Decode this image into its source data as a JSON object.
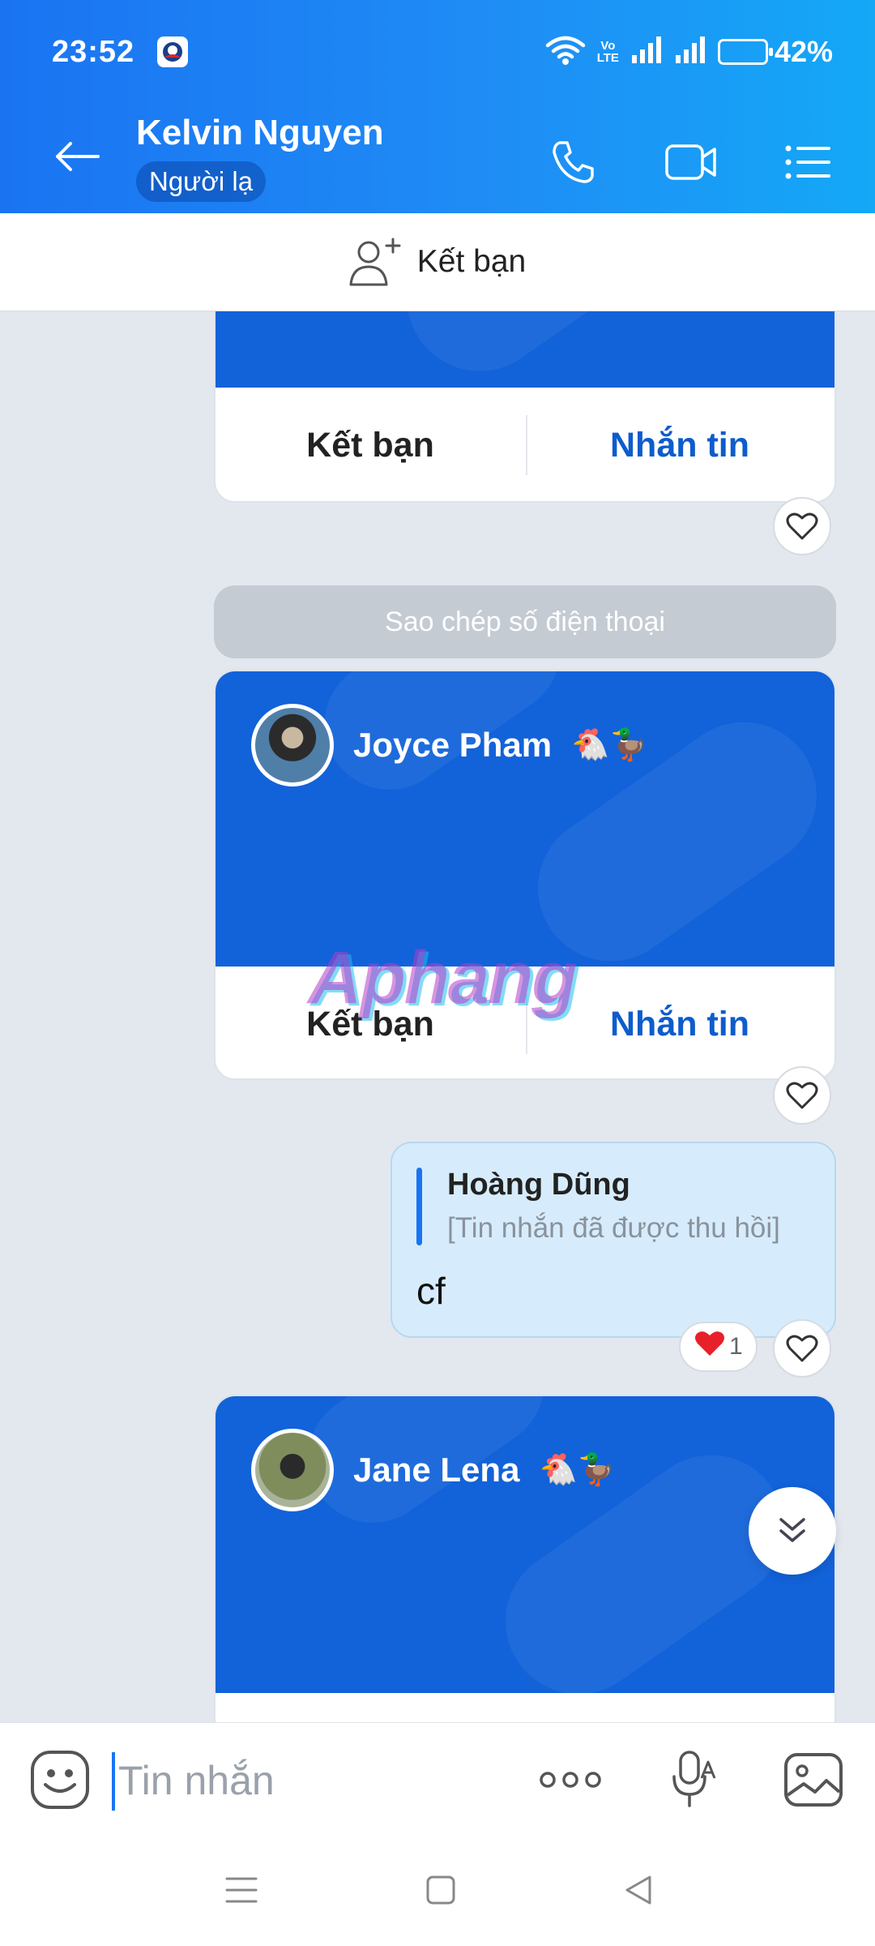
{
  "status_bar": {
    "time": "23:52",
    "network_label": "Vo\nLTE",
    "battery_percent": "42%",
    "battery_level": 0.42
  },
  "header": {
    "contact_name": "Kelvin Nguyen",
    "stranger_badge": "Người lạ"
  },
  "add_friend_bar": {
    "label": "Kết bạn"
  },
  "system_pill": {
    "label": "Sao chép số điện thoại"
  },
  "cards": [
    {
      "friend_label": "Kết bạn",
      "message_label": "Nhắn tin"
    },
    {
      "name": "Joyce Pham",
      "emojis": "🐔🦆",
      "friend_label": "Kết bạn",
      "message_label": "Nhắn tin"
    },
    {
      "name": "Jane Lena",
      "emojis": "🐔🦆"
    }
  ],
  "quoted_message": {
    "quote_name": "Hoàng Dũng",
    "quote_text": "[Tin nhắn đã được thu hồi]",
    "text": "cf"
  },
  "reaction": {
    "emoji": "❤️",
    "count": "1"
  },
  "watermark": "Aphang",
  "input": {
    "placeholder": "Tin nhắn"
  },
  "colors": {
    "header_start": "#1a74f2",
    "header_end": "#14a8f7",
    "card_blue": "#1262d9",
    "accent": "#0e5ccc"
  }
}
